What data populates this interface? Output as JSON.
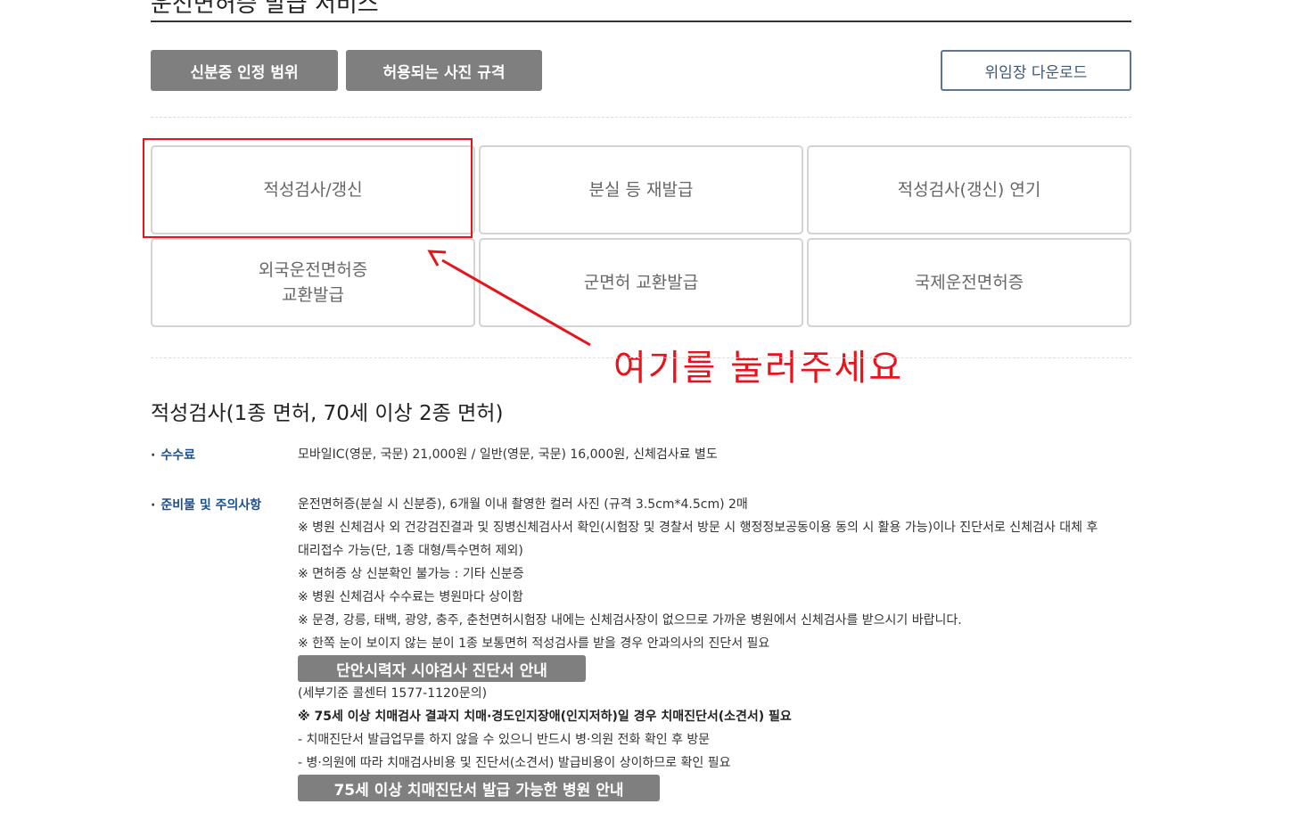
{
  "header": {
    "title": "운전면허증 발급 서비스"
  },
  "buttons": {
    "id_scope": "신분증 인정 범위",
    "photo_spec": "허용되는 사진 규격",
    "proxy_download": "위임장 다운로드"
  },
  "services": [
    {
      "label": "적성검사/갱신"
    },
    {
      "label": "분실 등 재발급"
    },
    {
      "label": "적성검사(갱신) 연기"
    },
    {
      "label_line1": "외국운전면허증",
      "label_line2": "교환발급"
    },
    {
      "label": "군면허 교환발급"
    },
    {
      "label": "국제운전면허증"
    }
  ],
  "annotation": {
    "text": "여기를 눌러주세요",
    "color": "#e8141c"
  },
  "section": {
    "title": "적성검사(1종 면허, 70세 이상 2종 면허)",
    "fee_label": "수수료",
    "fee_text": "모바일IC(영문, 국문) 21,000원 / 일반(영문, 국문) 16,000원, 신체검사료 별도",
    "prep_label": "준비물 및 주의사항",
    "lines": [
      "운전면허증(분실 시 신분증), 6개월 이내 촬영한 컬러 사진 (규격 3.5cm*4.5cm) 2매",
      "※ 병원 신체검사 외 건강검진결과 및 징병신체검사서 확인(시험장 및 경찰서 방문 시 행정정보공동이용 동의 시 활용 가능)이나 진단서로 신체검사 대체 후",
      "대리접수 가능(단, 1종 대형/특수면허 제외)",
      "※ 면허증 상 신분확인 불가능 : 기타 신분증",
      "※ 병원 신체검사 수수료는 병원마다 상이함",
      "※ 문경, 강릉, 태백, 광양, 충주, 춘천면허시험장 내에는 신체검사장이 없으므로 가까운 병원에서 신체검사를 받으시기 바랍니다.",
      "※ 한쪽 눈이 보이지 않는 분이 1종 보통면허 적성검사를 받을 경우 안과의사의 진단서 필요"
    ],
    "vision_button": "단안시력자 시야검사 진단서 안내",
    "call_center": "(세부기준 콜센터 1577-1120문의)",
    "dementia_notice": "※ 75세 이상 치매검사 결과지 치매·경도인지장애(인지저하)일 경우 치매진단서(소견서) 필요",
    "dementia_lines": [
      "- 치매진단서 발급업무를 하지 않을 수 있으니 반드시 병·의원 전화 확인 후 방문",
      "- 병·의원에 따라 치매검사비용 및 진단서(소견서) 발급비용이 상이하므로 확인 필요"
    ],
    "dementia_button": "75세 이상 치매진단서 발급 가능한 병원 안내"
  }
}
